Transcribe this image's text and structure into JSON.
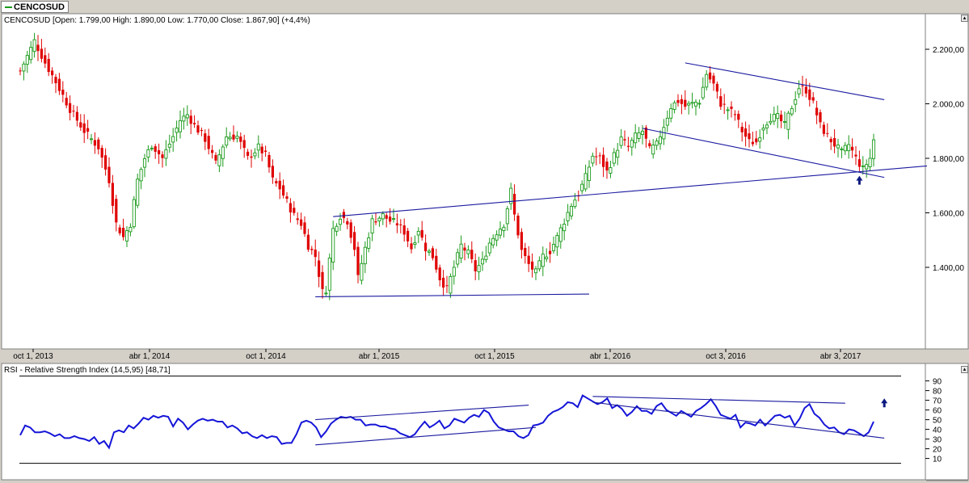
{
  "tab": {
    "label": "CENCOSUD"
  },
  "main_legend": {
    "text": "CENCOSUD [Open: 1.799,00  High: 1.890,00  Low: 1.770,00  Close: 1.867,90] (+4,4%)"
  },
  "rsi_legend": {
    "text": "RSI - Relative Strength Index (14,5,95) [48,71]"
  },
  "colors": {
    "up": "#1a9a1a",
    "down": "#e00000",
    "trend": "#1a1aa0",
    "rsi_line": "#1515d8",
    "arrow": "#0c1a80"
  },
  "chart_data": [
    {
      "type": "candlestick",
      "title": "CENCOSUD [Open: 1.799,00  High: 1.890,00  Low: 1.770,00  Close: 1.867,90] (+4,4%)",
      "last_bar": {
        "open": 1799.0,
        "high": 1890.0,
        "low": 1770.0,
        "close": 1867.9,
        "change": "+4,4%"
      },
      "x_tick_labels": [
        "oct 1, 2013",
        "abr 1, 2014",
        "oct 1, 2014",
        "abr 1, 2015",
        "oct 1, 2015",
        "abr 1, 2016",
        "oct 3, 2016",
        "abr 3, 2017"
      ],
      "y_tick_labels": [
        "1.400,00",
        "1.600,00",
        "1.800,00",
        "2.000,00",
        "2.200,00"
      ],
      "y_ticks": [
        1400,
        1600,
        1800,
        2000,
        2200
      ],
      "ylim": [
        1225,
        2270
      ],
      "grid": false,
      "close_path": [
        [
          0,
          2120
        ],
        [
          4,
          2230
        ],
        [
          7,
          2150
        ],
        [
          10,
          2080
        ],
        [
          14,
          1980
        ],
        [
          18,
          1900
        ],
        [
          22,
          1840
        ],
        [
          25,
          1720
        ],
        [
          27,
          1560
        ],
        [
          29,
          1510
        ],
        [
          31,
          1560
        ],
        [
          33,
          1720
        ],
        [
          35,
          1800
        ],
        [
          37,
          1850
        ],
        [
          40,
          1800
        ],
        [
          43,
          1880
        ],
        [
          45,
          1940
        ],
        [
          47,
          1960
        ],
        [
          49,
          1920
        ],
        [
          52,
          1870
        ],
        [
          55,
          1780
        ],
        [
          58,
          1880
        ],
        [
          61,
          1880
        ],
        [
          64,
          1800
        ],
        [
          67,
          1840
        ],
        [
          69,
          1810
        ],
        [
          71,
          1720
        ],
        [
          73,
          1690
        ],
        [
          75,
          1640
        ],
        [
          77,
          1590
        ],
        [
          79,
          1560
        ],
        [
          81,
          1480
        ],
        [
          83,
          1440
        ],
        [
          85,
          1310
        ],
        [
          86,
          1320
        ],
        [
          88,
          1540
        ],
        [
          90,
          1590
        ],
        [
          92,
          1570
        ],
        [
          94,
          1470
        ],
        [
          95,
          1360
        ],
        [
          97,
          1470
        ],
        [
          99,
          1570
        ],
        [
          102,
          1590
        ],
        [
          104,
          1570
        ],
        [
          106,
          1560
        ],
        [
          108,
          1530
        ],
        [
          110,
          1470
        ],
        [
          112,
          1540
        ],
        [
          114,
          1470
        ],
        [
          116,
          1440
        ],
        [
          118,
          1360
        ],
        [
          120,
          1320
        ],
        [
          122,
          1400
        ],
        [
          124,
          1480
        ],
        [
          126,
          1450
        ],
        [
          128,
          1390
        ],
        [
          130,
          1420
        ],
        [
          132,
          1490
        ],
        [
          134,
          1530
        ],
        [
          136,
          1560
        ],
        [
          138,
          1680
        ],
        [
          139,
          1590
        ],
        [
          141,
          1460
        ],
        [
          143,
          1410
        ],
        [
          145,
          1380
        ],
        [
          147,
          1440
        ],
        [
          149,
          1460
        ],
        [
          151,
          1510
        ],
        [
          153,
          1570
        ],
        [
          155,
          1630
        ],
        [
          157,
          1670
        ],
        [
          159,
          1730
        ],
        [
          161,
          1810
        ],
        [
          163,
          1800
        ],
        [
          165,
          1750
        ],
        [
          167,
          1810
        ],
        [
          169,
          1870
        ],
        [
          171,
          1840
        ],
        [
          173,
          1880
        ],
        [
          175,
          1900
        ],
        [
          177,
          1830
        ],
        [
          179,
          1850
        ],
        [
          181,
          1920
        ],
        [
          183,
          1990
        ],
        [
          185,
          2010
        ],
        [
          187,
          1990
        ],
        [
          189,
          2000
        ],
        [
          191,
          2010
        ],
        [
          193,
          2110
        ],
        [
          195,
          2070
        ],
        [
          197,
          2000
        ],
        [
          199,
          1980
        ],
        [
          201,
          1960
        ],
        [
          203,
          1900
        ],
        [
          205,
          1860
        ],
        [
          207,
          1860
        ],
        [
          209,
          1920
        ],
        [
          211,
          1950
        ],
        [
          213,
          1950
        ],
        [
          215,
          1920
        ],
        [
          217,
          1990
        ],
        [
          219,
          2060
        ],
        [
          221,
          2050
        ],
        [
          223,
          2000
        ],
        [
          225,
          1920
        ],
        [
          227,
          1880
        ],
        [
          229,
          1850
        ],
        [
          231,
          1820
        ],
        [
          233,
          1850
        ],
        [
          235,
          1800
        ],
        [
          237,
          1760
        ],
        [
          239,
          1800
        ],
        [
          240,
          1868
        ]
      ],
      "trendlines": [
        {
          "from": [
            88,
            1586
          ],
          "to": [
            255,
            1772
          ]
        },
        {
          "from": [
            83,
            1292
          ],
          "to": [
            160,
            1302
          ]
        },
        {
          "from": [
            187,
            2150
          ],
          "to": [
            243,
            2015
          ]
        },
        {
          "from": [
            175,
            1910
          ],
          "to": [
            243,
            1730
          ]
        }
      ],
      "annotation": {
        "type": "up-arrow",
        "x": 236,
        "y": 1718
      }
    },
    {
      "type": "line",
      "title": "RSI - Relative Strength Index (14,5,95) [48,71]",
      "series": [
        {
          "values": [
            34,
            44,
            42,
            37,
            37,
            38,
            36,
            33,
            35,
            31,
            31,
            33,
            31,
            30,
            28,
            32,
            25,
            28,
            21,
            37,
            39,
            37,
            44,
            41,
            46,
            52,
            50,
            54,
            52,
            54,
            53,
            43,
            51,
            47,
            40,
            45,
            49,
            51,
            49,
            50,
            48,
            48,
            42,
            44,
            41,
            36,
            37,
            33,
            31,
            34,
            31,
            33,
            32,
            25,
            26,
            26,
            35,
            47,
            49,
            47,
            42,
            32,
            38,
            46,
            50,
            53,
            52,
            53,
            50,
            50,
            44,
            45,
            45,
            43,
            43,
            41,
            40,
            36,
            34,
            32,
            35,
            42,
            48,
            42,
            45,
            49,
            41,
            44,
            51,
            49,
            47,
            52,
            55,
            53,
            60,
            57,
            48,
            42,
            40,
            38,
            38,
            33,
            31,
            34,
            44,
            45,
            47,
            54,
            58,
            60,
            63,
            68,
            67,
            63,
            75,
            72,
            69,
            66,
            68,
            72,
            62,
            65,
            61,
            54,
            58,
            64,
            59,
            59,
            56,
            64,
            67,
            60,
            57,
            54,
            59,
            56,
            53,
            59,
            62,
            66,
            71,
            64,
            55,
            53,
            51,
            55,
            42,
            47,
            46,
            44,
            50,
            44,
            49,
            54,
            55,
            52,
            54,
            44,
            51,
            62,
            66,
            56,
            52,
            45,
            41,
            42,
            37,
            35,
            40,
            39,
            36,
            33,
            37,
            48
          ]
        }
      ],
      "y_tick_labels": [
        "10",
        "20",
        "30",
        "40",
        "50",
        "60",
        "70",
        "80",
        "90"
      ],
      "y_ticks": [
        10,
        20,
        30,
        40,
        50,
        60,
        70,
        80,
        90
      ],
      "ylim": [
        5,
        97
      ],
      "trendlines": [
        {
          "from": [
            83,
            24
          ],
          "to": [
            145,
            42
          ]
        },
        {
          "from": [
            83,
            50
          ],
          "to": [
            143,
            65
          ]
        },
        {
          "from": [
            161,
            74
          ],
          "to": [
            232,
            67
          ]
        },
        {
          "from": [
            161,
            68
          ],
          "to": [
            243,
            31
          ]
        }
      ],
      "annotation": {
        "type": "up-arrow",
        "x": 243,
        "y": 67
      }
    }
  ]
}
